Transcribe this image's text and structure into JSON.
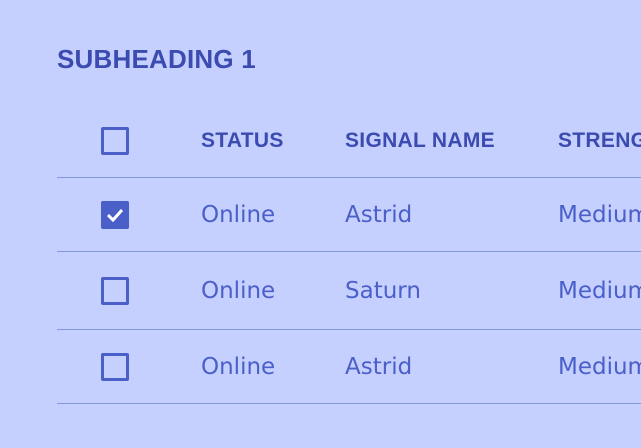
{
  "section": {
    "title": "SUBHEADING 1"
  },
  "table": {
    "headers": {
      "status": "STATUS",
      "name": "SIGNAL NAME",
      "strength": "STRENGTH"
    },
    "rows": [
      {
        "checked": true,
        "status": "Online",
        "name": "Astrid",
        "strength": "Medium"
      },
      {
        "checked": false,
        "status": "Online",
        "name": "Saturn",
        "strength": "Medium"
      },
      {
        "checked": false,
        "status": "Online",
        "name": "Astrid",
        "strength": "Medium"
      }
    ]
  },
  "colors": {
    "background": "#c5d0ff",
    "heading": "#3b4bb0",
    "text": "#4a5fc8",
    "divider": "#8598dc"
  }
}
